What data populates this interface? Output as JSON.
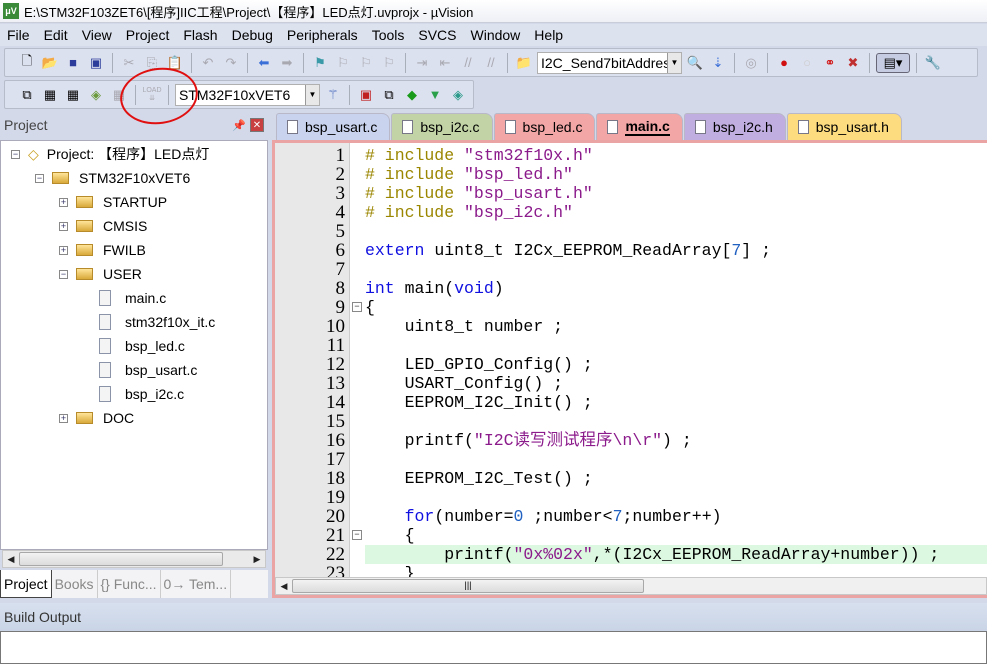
{
  "window": {
    "title": "E:\\STM32F103ZET6\\[程序]IIC工程\\Project\\【程序】LED点灯.uvprojx - µVision"
  },
  "menu": [
    "File",
    "Edit",
    "View",
    "Project",
    "Flash",
    "Debug",
    "Peripherals",
    "Tools",
    "SVCS",
    "Window",
    "Help"
  ],
  "toolbar": {
    "find_combo": "I2C_Send7bitAddress",
    "target_combo": "STM32F10xVET6",
    "load_label": "LOAD"
  },
  "project_panel": {
    "title": "Project",
    "root": "Project: 【程序】LED点灯",
    "target": "STM32F10xVET6",
    "groups": [
      {
        "name": "STARTUP",
        "expanded": false
      },
      {
        "name": "CMSIS",
        "expanded": false
      },
      {
        "name": "FWILB",
        "expanded": false
      },
      {
        "name": "USER",
        "expanded": true,
        "files": [
          "main.c",
          "stm32f10x_it.c",
          "bsp_led.c",
          "bsp_usart.c",
          "bsp_i2c.c"
        ]
      },
      {
        "name": "DOC",
        "expanded": false
      }
    ],
    "tabs": [
      "Project",
      "Books",
      "{} Func...",
      "0→ Tem..."
    ]
  },
  "editor": {
    "tabs": [
      {
        "label": "bsp_usart.c",
        "color": "#c9d3ee"
      },
      {
        "label": "bsp_i2c.c",
        "color": "#c2d4a6"
      },
      {
        "label": "bsp_led.c",
        "color": "#f2a6a6"
      },
      {
        "label": "main.c",
        "color": "#f2a6a6",
        "active": true
      },
      {
        "label": "bsp_i2c.h",
        "color": "#c0aee0"
      },
      {
        "label": "bsp_usart.h",
        "color": "#fddc80"
      }
    ],
    "highlight_line": 22,
    "fold_lines": [
      9,
      21
    ],
    "lines": [
      [
        [
          "pp",
          "# include "
        ],
        [
          "str",
          "\"stm32f10x.h\""
        ]
      ],
      [
        [
          "pp",
          "# include "
        ],
        [
          "str",
          "\"bsp_led.h\""
        ]
      ],
      [
        [
          "pp",
          "# include "
        ],
        [
          "str",
          "\"bsp_usart.h\""
        ]
      ],
      [
        [
          "pp",
          "# include "
        ],
        [
          "str",
          "\"bsp_i2c.h\""
        ]
      ],
      [],
      [
        [
          "kw",
          "extern"
        ],
        [
          "op",
          " uint8_t I2Cx_EEPROM_ReadArray["
        ],
        [
          "num",
          "7"
        ],
        [
          "op",
          "] ;"
        ]
      ],
      [],
      [
        [
          "kw",
          "int"
        ],
        [
          "op",
          " main("
        ],
        [
          "kw",
          "void"
        ],
        [
          "op",
          ")"
        ]
      ],
      [
        [
          "op",
          "{"
        ]
      ],
      [
        [
          "op",
          "    uint8_t number ;"
        ]
      ],
      [],
      [
        [
          "op",
          "    LED_GPIO_Config() ;"
        ]
      ],
      [
        [
          "op",
          "    USART_Config() ;"
        ]
      ],
      [
        [
          "op",
          "    EEPROM_I2C_Init() ;"
        ]
      ],
      [],
      [
        [
          "op",
          "    printf("
        ],
        [
          "str",
          "\"I2C读写测试程序\\n\\r\""
        ],
        [
          "op",
          ") ;"
        ]
      ],
      [],
      [
        [
          "op",
          "    EEPROM_I2C_Test() ;"
        ]
      ],
      [],
      [
        [
          "op",
          "    "
        ],
        [
          "kw",
          "for"
        ],
        [
          "op",
          "(number="
        ],
        [
          "num",
          "0"
        ],
        [
          "op",
          " ;number<"
        ],
        [
          "num",
          "7"
        ],
        [
          "op",
          ";number++)"
        ]
      ],
      [
        [
          "op",
          "    {"
        ]
      ],
      [
        [
          "op",
          "        printf("
        ],
        [
          "str",
          "\"0x%02x\""
        ],
        [
          "op",
          ",*(I2Cx_EEPROM_ReadArray+number)) ;"
        ]
      ],
      [
        [
          "op",
          "    }"
        ]
      ]
    ]
  },
  "build_output": {
    "title": "Build Output"
  }
}
